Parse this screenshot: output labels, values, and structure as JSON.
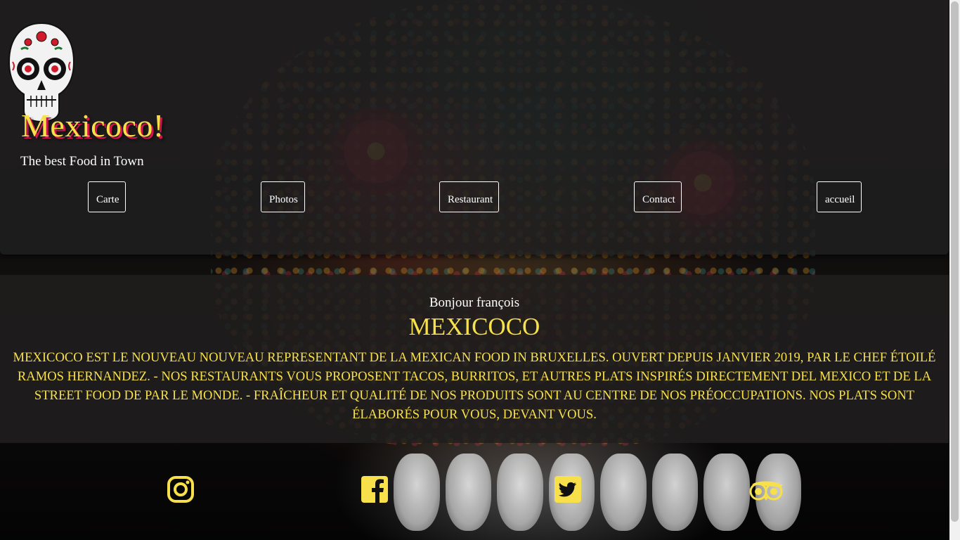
{
  "header": {
    "site_title": "Mexicoco!",
    "tagline": "The best Food in Town",
    "logo_icon": "sugar-skull-icon"
  },
  "nav": {
    "items": [
      {
        "label": "Carte"
      },
      {
        "label": "Photos"
      },
      {
        "label": "Restaurant"
      },
      {
        "label": "Contact"
      },
      {
        "label": "accueil"
      }
    ]
  },
  "intro": {
    "greeting": "Bonjour françois",
    "heading": "MEXICOCO",
    "description": "MEXICOCO EST LE NOUVEAU NOUVEAU REPRESENTANT DE LA MEXICAN FOOD IN BRUXELLES. OUVERT DEPUIS JANVIER 2019, PAR LE CHEF ÉTOILÉ RAMOS HERNANDEZ. - NOS RESTAURANTS VOUS PROPOSENT TACOS, BURRITOS, ET AUTRES PLATS INSPIRÉS DIRECTEMENT DEL MEXICO ET DE LA STREET FOOD DE PAR LE MONDE. - FRAÎCHEUR ET QUALITÉ DE NOS PRODUITS SONT AU CENTRE DE NOS PRÉOCCUPATIONS. NOS PLATS SONT ÉLABORÉS POUR VOUS, DEVANT VOUS."
  },
  "social": {
    "icons": [
      "instagram-icon",
      "facebook-icon",
      "twitter-icon",
      "tripadvisor-icon"
    ]
  },
  "colors": {
    "accent": "#f7e04a",
    "title_shadow": "#d4124f",
    "panel": "#201e1e",
    "text": "#ffffff"
  }
}
